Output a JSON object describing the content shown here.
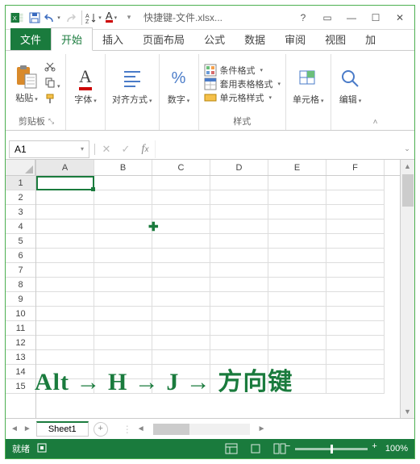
{
  "window": {
    "title": "快捷键-文件.xlsx..."
  },
  "qat": {
    "save_icon": "save-icon",
    "undo_icon": "undo-icon",
    "redo_icon": "redo-icon",
    "sort_icon": "sort-icon",
    "text_icon": "A"
  },
  "tabs": {
    "file": "文件",
    "items": [
      "开始",
      "插入",
      "页面布局",
      "公式",
      "数据",
      "审阅",
      "视图",
      "加"
    ]
  },
  "ribbon": {
    "clipboard": {
      "paste": "粘贴",
      "label": "剪贴板"
    },
    "font": {
      "label": "字体"
    },
    "align": {
      "label": "对齐方式"
    },
    "number": {
      "label": "数字"
    },
    "styles": {
      "cond": "条件格式",
      "table": "套用表格格式",
      "cell": "单元格样式",
      "label": "样式"
    },
    "cells": {
      "label": "单元格"
    },
    "editing": {
      "label": "编辑"
    }
  },
  "formula": {
    "name_box": "A1"
  },
  "grid": {
    "columns": [
      "A",
      "B",
      "C",
      "D",
      "E",
      "F"
    ],
    "rows": [
      "1",
      "2",
      "3",
      "4",
      "5",
      "6",
      "7",
      "8",
      "9",
      "10",
      "11",
      "12",
      "13",
      "14",
      "15"
    ]
  },
  "sheets": {
    "tab": "Sheet1"
  },
  "status": {
    "ready": "就绪",
    "zoom": "100%"
  },
  "overlay": {
    "text": "Alt → H → J → 方向键"
  }
}
